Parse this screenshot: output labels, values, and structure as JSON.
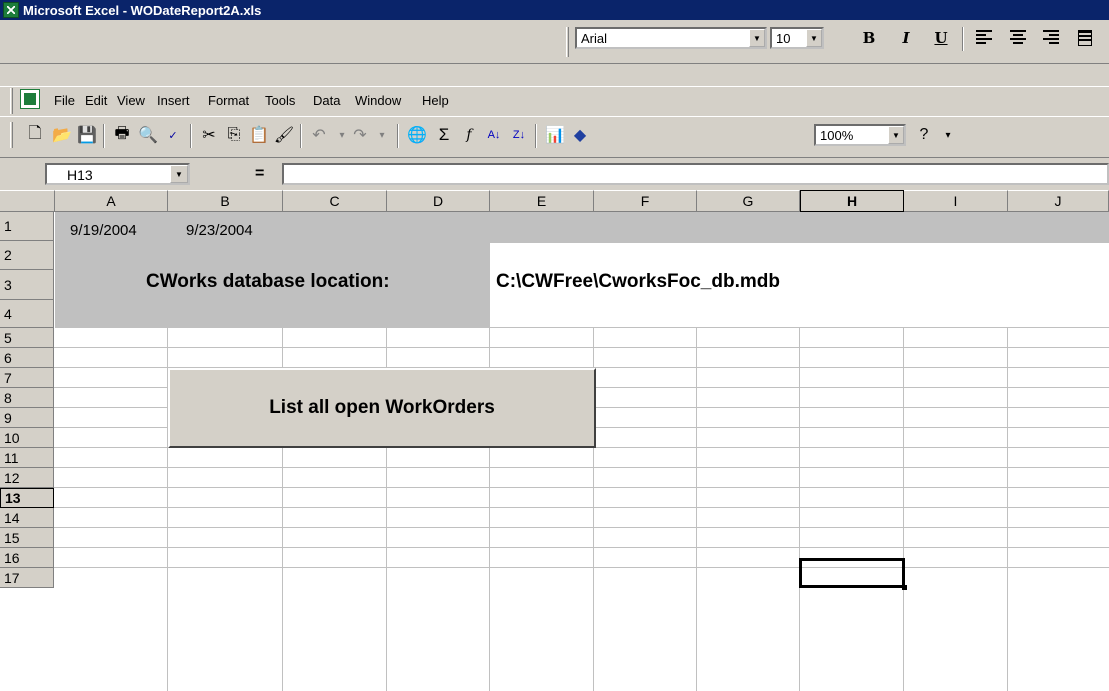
{
  "window": {
    "title": "Microsoft Excel - WODateReport2A.xls"
  },
  "format_toolbar": {
    "font": "Arial",
    "size": "10",
    "bold": "B",
    "italic": "I",
    "underline": "U"
  },
  "menu": [
    "File",
    "Edit",
    "View",
    "Insert",
    "Format",
    "Tools",
    "Data",
    "Window",
    "Help"
  ],
  "standard_toolbar": {
    "zoom": "100%",
    "icons": [
      "new-icon",
      "open-icon",
      "save-icon",
      "print-icon",
      "print-preview-icon",
      "spelling-icon",
      "cut-icon",
      "copy-icon",
      "paste-icon",
      "format-painter-icon",
      "undo-icon",
      "redo-icon",
      "hyperlink-icon",
      "autosum-icon",
      "function-icon",
      "sort-ascending-icon",
      "sort-descending-icon",
      "chart-wizard-icon",
      "drawing-icon",
      "help-icon"
    ]
  },
  "formula_bar": {
    "name_box": "H13",
    "equals": "=",
    "formula": ""
  },
  "columns": [
    "A",
    "B",
    "C",
    "D",
    "E",
    "F",
    "G",
    "H",
    "I",
    "J"
  ],
  "rows": [
    "1",
    "2",
    "3",
    "4",
    "5",
    "6",
    "7",
    "8",
    "9",
    "10",
    "11",
    "12",
    "13",
    "14",
    "15",
    "16",
    "17"
  ],
  "cells": {
    "A1": "9/19/2004",
    "B1": "9/23/2004",
    "db_label": "CWorks database location:",
    "db_path": "C:\\CWFree\\CworksFoc_db.mdb"
  },
  "button": {
    "label": "List all open WorkOrders"
  },
  "selection": {
    "column": "H",
    "row": "13"
  },
  "colors": {
    "title_bar": "#0a246a",
    "chrome": "#d4d0c8",
    "band": "#c0c0c0"
  }
}
